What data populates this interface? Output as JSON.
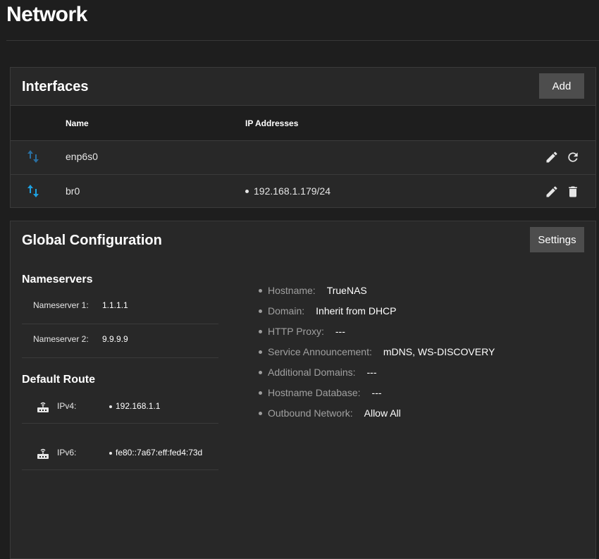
{
  "page": {
    "title": "Network"
  },
  "interfaces": {
    "title": "Interfaces",
    "add_label": "Add",
    "columns": {
      "name": "Name",
      "ip": "IP Addresses"
    },
    "rows": [
      {
        "name": "enp6s0",
        "ip": "",
        "icon": "swap-vertical-icon",
        "actions": [
          "edit-icon",
          "refresh-icon"
        ]
      },
      {
        "name": "br0",
        "ip": "192.168.1.179/24",
        "icon": "swap-vertical-icon",
        "actions": [
          "edit-icon",
          "delete-icon"
        ]
      }
    ]
  },
  "global": {
    "title": "Global Configuration",
    "settings_label": "Settings",
    "nameservers": {
      "title": "Nameservers",
      "items": [
        {
          "label": "Nameserver 1:",
          "value": "1.1.1.1"
        },
        {
          "label": "Nameserver 2:",
          "value": "9.9.9.9"
        }
      ]
    },
    "default_route": {
      "title": "Default Route",
      "items": [
        {
          "label": "IPv4:",
          "value": "192.168.1.1",
          "icon": "router-icon"
        },
        {
          "label": "IPv6:",
          "value": "fe80::7a67:eff:fed4:73d",
          "icon": "router-icon"
        }
      ]
    },
    "details": [
      {
        "key": "Hostname:",
        "value": "TrueNAS"
      },
      {
        "key": "Domain:",
        "value": "Inherit from DHCP"
      },
      {
        "key": "HTTP Proxy:",
        "value": "---"
      },
      {
        "key": "Service Announcement:",
        "value": "mDNS, WS-DISCOVERY"
      },
      {
        "key": "Additional Domains:",
        "value": "---"
      },
      {
        "key": "Hostname Database:",
        "value": "---"
      },
      {
        "key": "Outbound Network:",
        "value": "Allow All"
      }
    ]
  },
  "colors": {
    "background": "#1e1e1e",
    "card": "#282828",
    "button": "#4d4d4d",
    "link_up": "#1ea0e0",
    "link_down": "#2a6fa0"
  }
}
